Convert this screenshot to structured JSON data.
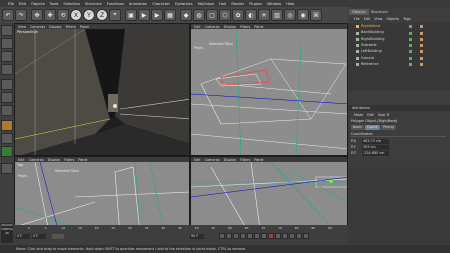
{
  "menu": [
    "File",
    "Edit",
    "Objects",
    "Tools",
    "Selection",
    "Structure",
    "Functions",
    "Animation",
    "Character",
    "Dynamics",
    "MoGraph",
    "Hair",
    "Render",
    "Plugins",
    "Window",
    "Help"
  ],
  "toolbar": {
    "glyphs": [
      "↶",
      "↷",
      "✥",
      "✚",
      "⟲",
      "X",
      "Y",
      "Z",
      "⌖",
      "▣",
      "▶",
      "▶",
      "▦",
      "◆",
      "◍",
      "▢",
      "⬡",
      "✿",
      "◐",
      "☀",
      "▥",
      "◎",
      "◉",
      "⌘"
    ]
  },
  "viewports": {
    "perspective": {
      "name": "Perspective",
      "menu": [
        "View",
        "Cameras",
        "Display",
        "Filters",
        "Panel"
      ]
    },
    "top_right": {
      "menu": [
        "Edit",
        "Cameras",
        "Display",
        "Filters",
        "Panel"
      ],
      "selected": "Selected Total",
      "polys_label": "Polys"
    },
    "bottom_left": {
      "name": "Top",
      "menu": [
        "Edit",
        "Cameras",
        "Display",
        "Filters",
        "Panel"
      ],
      "selected": "Selected Total",
      "polys_label": "Polys"
    },
    "bottom_right": {
      "menu": [
        "Edit",
        "Cameras",
        "Display",
        "Filters",
        "Panel"
      ]
    }
  },
  "object_manager": {
    "tabs": [
      "Objects",
      "Structure"
    ],
    "menu": [
      "File",
      "Edit",
      "View",
      "Objects",
      "Tags"
    ],
    "items": [
      {
        "name": "RightWand",
        "selected": true
      },
      {
        "name": "BackBuilding",
        "selected": false
      },
      {
        "name": "RightBuilding",
        "selected": false
      },
      {
        "name": "Sidewalk",
        "selected": false
      },
      {
        "name": "LeftBuilding",
        "selected": false
      },
      {
        "name": "Ground",
        "selected": false
      },
      {
        "name": "Reference",
        "selected": false
      }
    ]
  },
  "attributes": {
    "title": "Attributes",
    "menu": [
      "Mode",
      "Edit",
      "User D"
    ],
    "object_label": "Polygon Object [RightBase]",
    "tabs": [
      "Basic",
      "Coord.",
      "Phong"
    ],
    "section": "Coordinates",
    "rows": [
      {
        "axis": "P.X",
        "value": "463.73 cm"
      },
      {
        "axis": "P.Y",
        "value": "205 cm"
      },
      {
        "axis": "P.Z",
        "value": "-234.685 cm"
      }
    ]
  },
  "timeline": {
    "start": "0 F",
    "current": "0 F",
    "end": "90 F",
    "ticks": [
      "0",
      "5",
      "10",
      "15",
      "20",
      "25",
      "30",
      "35",
      "40",
      "45",
      "50",
      "55",
      "60",
      "65",
      "70",
      "75",
      "80",
      "85",
      "90"
    ]
  },
  "status": "Move: Click and drag to move elements. Hold down SHIFT to quantize movement / add to the selection in point mode, CTRL to remove.",
  "logo": "MAXON CINEMA 4D"
}
